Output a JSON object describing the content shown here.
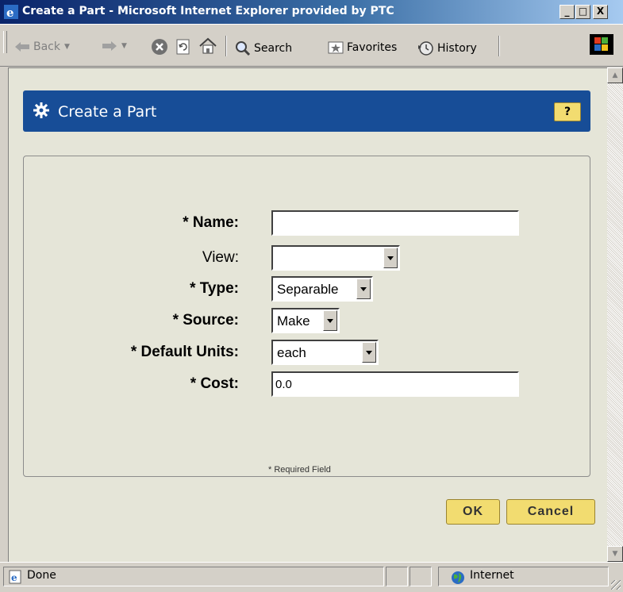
{
  "window": {
    "title": "Create a Part - Microsoft Internet Explorer provided by PTC",
    "minimize": "_",
    "maximize": "□",
    "close": "X"
  },
  "toolbar": {
    "back_label": "Back",
    "search_label": "Search",
    "favorites_label": "Favorites",
    "history_label": "History"
  },
  "page": {
    "title": "Create a Part",
    "help_label": "?"
  },
  "form": {
    "name_label": "* Name:",
    "name_value": "",
    "view_label": "View:",
    "view_value": "",
    "type_label": "* Type:",
    "type_value": "Separable",
    "source_label": "* Source:",
    "source_value": "Make",
    "units_label": "* Default Units:",
    "units_value": "each",
    "cost_label": "* Cost:",
    "cost_value": "0.0",
    "required_note": "* Required Field"
  },
  "actions": {
    "ok_label": "OK",
    "cancel_label": "Cancel"
  },
  "status": {
    "text": "Done",
    "zone": "Internet"
  },
  "colors": {
    "header_bg": "#174d97",
    "button_bg": "#f2dc70",
    "content_bg": "#e5e5d8"
  }
}
